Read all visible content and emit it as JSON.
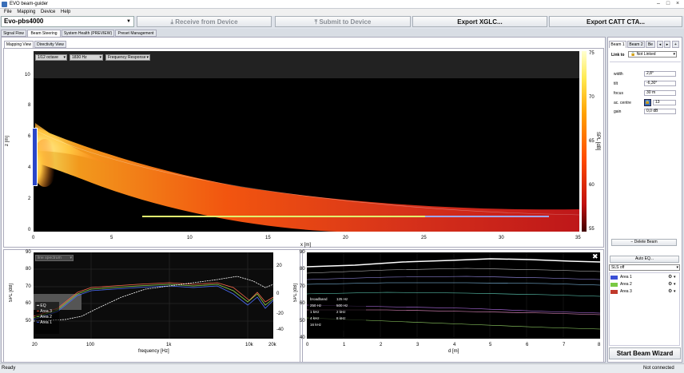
{
  "window": {
    "title": "EVO beam-guider"
  },
  "menu": [
    "File",
    "Mapping",
    "Device",
    "Help"
  ],
  "toolbar": {
    "device": "Evo-pbs4000",
    "receive": "Receive from Device",
    "submit": "Submit to Device",
    "export_xglc": "Export XGLC...",
    "export_catt": "Export CATT CTA..."
  },
  "main_tabs": [
    "Signal Flow",
    "Beam Steering",
    "System Health (PREVIEW)",
    "Preset Management"
  ],
  "view_tabs": [
    "Mapping View",
    "Directivity View"
  ],
  "mapping": {
    "octave": "1/12 octave",
    "freq": "1830 Hz",
    "mode": "Frequency Response",
    "xlabel": "x [m]",
    "ylabel": "z [m]",
    "colorbar_label": "SPL [dB]",
    "x_ticks": [
      "0",
      "5",
      "10",
      "15",
      "20",
      "25",
      "30",
      "35"
    ],
    "y_ticks": [
      "0",
      "2",
      "4",
      "6",
      "8",
      "10"
    ],
    "cb_ticks": [
      "75",
      "70",
      "65",
      "60",
      "55"
    ]
  },
  "spectrum": {
    "mode": "line spectrum",
    "xlabel": "frequency [Hz]",
    "ylabel": "SPL [dB]",
    "x_ticks": [
      "20",
      "100",
      "1k",
      "10k",
      "20k"
    ],
    "y_ticks": [
      "90",
      "80",
      "70",
      "60",
      "50"
    ],
    "y2_ticks": [
      "20",
      "0",
      "-20",
      "-40"
    ],
    "legend": [
      {
        "name": "EQ",
        "color": "#ffffff"
      },
      {
        "name": "Area 3",
        "color": "#ff6a4d"
      },
      {
        "name": "Area 2",
        "color": "#8fd34a"
      },
      {
        "name": "Area 1",
        "color": "#4d6fff"
      }
    ]
  },
  "distance": {
    "xlabel": "d [m]",
    "ylabel": "SPL [dB]",
    "x_ticks": [
      "0",
      "1",
      "2",
      "3",
      "4",
      "5",
      "6",
      "7",
      "8"
    ],
    "y_ticks": [
      "90",
      "80",
      "70",
      "60",
      "50",
      "40"
    ],
    "legend": [
      {
        "name": "broadband",
        "color": "#ffffff"
      },
      {
        "name": "125 Hz",
        "color": "#ffffff"
      },
      {
        "name": "250 Hz",
        "color": "#ffffff"
      },
      {
        "name": "500 Hz",
        "color": "#ffffff"
      },
      {
        "name": "1 kHz",
        "color": "#ffffff"
      },
      {
        "name": "2 kHz",
        "color": "#ffffff"
      },
      {
        "name": "4 kHz",
        "color": "#ffffff"
      },
      {
        "name": "8 kHz",
        "color": "#ffffff"
      },
      {
        "name": "16 kHz",
        "color": "#ffffff"
      }
    ]
  },
  "right_panel": {
    "beam_tabs": [
      "Beam 1",
      "Beam 2",
      "Be"
    ],
    "link_label": "Link to",
    "link_value": "Not Linked",
    "width_label": "width",
    "width_value": "2,8°",
    "tilt_label": "tilt",
    "tilt_value": "-6,30°",
    "focus_label": "focus",
    "focus_value": "30 m",
    "centre_label": "ac. centre",
    "centre_value": "13",
    "gain_label": "gain",
    "gain_value": "0,0 dB",
    "delete_beam": "Delete Beam",
    "auto_eq": "Auto EQ...",
    "sls": "SLS off",
    "areas": [
      {
        "name": "Area 1",
        "color": "#3b50d6"
      },
      {
        "name": "Area 2",
        "color": "#7ac943"
      },
      {
        "name": "Area 3",
        "color": "#c0392b"
      }
    ],
    "start_wizard": "Start Beam Wizard"
  },
  "status": {
    "left": "Ready",
    "right": "Not connected"
  }
}
